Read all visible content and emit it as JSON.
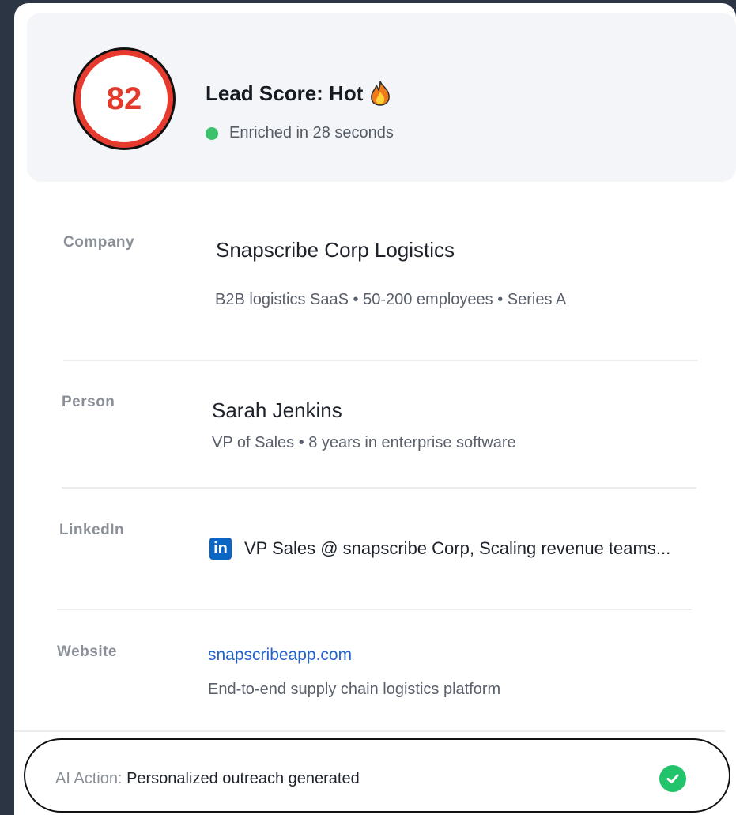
{
  "score": {
    "value": "82",
    "title": "Lead Score: Hot",
    "title_icon": "fire-icon",
    "status_text": "Enriched in 28 seconds",
    "status_color": "#3cc26c",
    "ring_color": "#e63a2e"
  },
  "company": {
    "label": "Company",
    "name": "Snapscribe Corp Logistics",
    "details": "B2B logistics SaaS • 50-200 employees • Series A"
  },
  "person": {
    "label": "Person",
    "name": "Sarah Jenkins",
    "details": "VP of Sales • 8 years in enterprise software"
  },
  "linkedin": {
    "label": "LinkedIn",
    "icon": "linkedin-icon",
    "headline": "VP Sales @ snapscribe Corp, Scaling revenue teams..."
  },
  "website": {
    "label": "Website",
    "url": "snapscribeapp.com",
    "description": "End-to-end supply chain logistics platform"
  },
  "ai_action": {
    "prefix": "AI Action:",
    "value": "Personalized outreach generated",
    "status_icon": "check-circle-icon",
    "status_color": "#22c46b"
  }
}
